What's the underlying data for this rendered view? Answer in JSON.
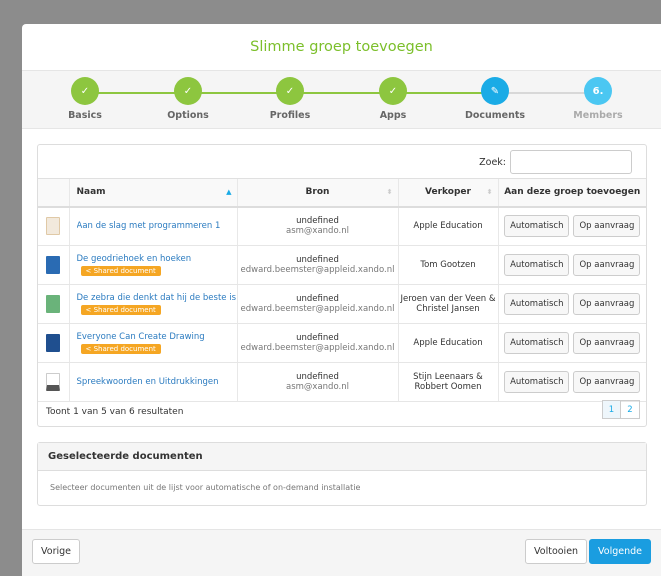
{
  "modal": {
    "title": "Slimme groep toevoegen"
  },
  "steps": [
    {
      "label": "Basics",
      "state": "done",
      "mark": "✓"
    },
    {
      "label": "Options",
      "state": "done",
      "mark": "✓"
    },
    {
      "label": "Profiles",
      "state": "done",
      "mark": "✓"
    },
    {
      "label": "Apps",
      "state": "done",
      "mark": "✓"
    },
    {
      "label": "Documents",
      "state": "active",
      "mark": "✎"
    },
    {
      "label": "Members",
      "state": "todo",
      "mark": "6."
    }
  ],
  "search": {
    "label": "Zoek:",
    "value": ""
  },
  "table": {
    "headers": [
      "",
      "Naam",
      "Bron",
      "Verkoper",
      "Aan deze groep toevoegen"
    ],
    "rows": [
      {
        "name": "Aan de slag met programmeren 1",
        "shared": "",
        "bron": "undefined",
        "bron_email": "asm@xando.nl",
        "verkoper": "Apple Education",
        "thumb": "#f2e9dc",
        "btn_auto": "Automatisch",
        "btn_req": "Op aanvraag"
      },
      {
        "name": "De geodriehoek en hoeken",
        "shared": "< Shared document",
        "bron": "undefined",
        "bron_email": "edward.beemster@appleid.xando.nl",
        "verkoper": "Tom Gootzen",
        "thumb": "#2a6bb3",
        "btn_auto": "Automatisch",
        "btn_req": "Op aanvraag"
      },
      {
        "name": "De zebra die denkt dat hij de beste is",
        "shared": "< Shared document",
        "bron": "undefined",
        "bron_email": "edward.beemster@appleid.xando.nl",
        "verkoper": "Jeroen van der Veen & Christel Jansen",
        "thumb": "#6ab37a",
        "btn_auto": "Automatisch",
        "btn_req": "Op aanvraag"
      },
      {
        "name": "Everyone Can Create Drawing",
        "shared": "< Shared document",
        "bron": "undefined",
        "bron_email": "edward.beemster@appleid.xando.nl",
        "verkoper": "Apple Education",
        "thumb": "#1f4f8f",
        "btn_auto": "Automatisch",
        "btn_req": "Op aanvraag"
      },
      {
        "name": "Spreekwoorden en Uitdrukkingen",
        "shared": "",
        "bron": "undefined",
        "bron_email": "asm@xando.nl",
        "verkoper": "Stijn Leenaars & Robbert Oomen",
        "thumb": "#555555",
        "btn_auto": "Automatisch",
        "btn_req": "Op aanvraag"
      }
    ],
    "info": "Toont 1 van 5 van 6 resultaten",
    "pages": [
      "1",
      "2"
    ]
  },
  "selected": {
    "title": "Geselecteerde documenten",
    "body": "Selecteer documenten uit de lijst voor automatische of on-demand installatie"
  },
  "footer": {
    "prev": "Vorige",
    "finish": "Voltooien",
    "next": "Volgende"
  },
  "colors": {
    "green": "#8dc63f",
    "blue": "#1aabe6",
    "badge": "#f5a623",
    "link": "#2b7bc0"
  }
}
